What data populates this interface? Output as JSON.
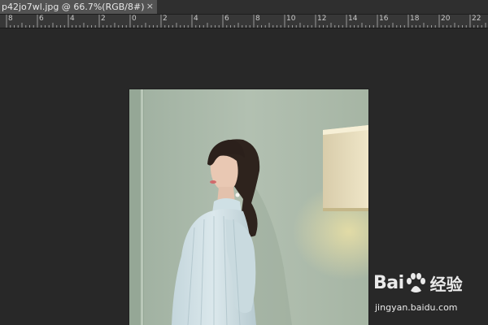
{
  "document_tab": {
    "title": "p42jo7wl.jpg @ 66.7%(RGB/8#)",
    "close_glyph": "×"
  },
  "ruler": {
    "labels": [
      "8",
      "6",
      "4",
      "2",
      "0",
      "2",
      "4",
      "6",
      "8",
      "10",
      "12",
      "14",
      "16",
      "18",
      "20",
      "22"
    ]
  },
  "watermark": {
    "brand_latin": "Bai",
    "brand_cn": "经验",
    "url": "jingyan.baidu.com",
    "logo_icon": "paw-icon"
  },
  "colors": {
    "workspace": "#282828",
    "ruler_bg": "#373737",
    "tab_active": "#535353",
    "photo_wall": "#a8b7a7"
  }
}
